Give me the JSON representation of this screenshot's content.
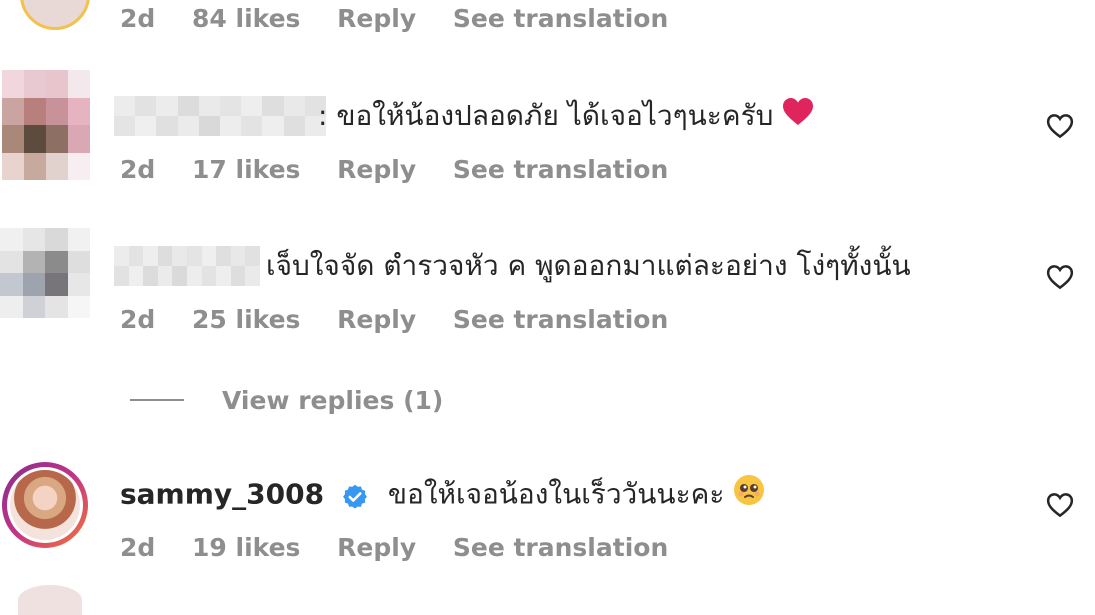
{
  "comments": [
    {
      "text": "",
      "time": "2d",
      "likes": "84 likes",
      "reply": "Reply",
      "translate": "See translation"
    },
    {
      "text": "ขอให้น้องปลอดภัย ได้เจอไวๆนะครับ",
      "time": "2d",
      "likes": "17 likes",
      "reply": "Reply",
      "translate": "See translation"
    },
    {
      "text": "เจ็บใจจัด ตำรวจหัว ค พูดออกมาแต่ละอย่าง โง่ๆทั้งนั้น",
      "time": "2d",
      "likes": "25 likes",
      "reply": "Reply",
      "translate": "See translation",
      "view_replies": "View replies (1)"
    },
    {
      "username": "sammy_3008",
      "text": "ขอให้เจอน้องในเร็ววันนะคะ",
      "time": "2d",
      "likes": "19 likes",
      "reply": "Reply",
      "translate": "See translation"
    }
  ],
  "icons": {
    "like": "heart-outline-icon",
    "verified": "verified-badge-icon",
    "red_heart": "red-heart-emoji-icon",
    "pleading_face": "pleading-face-emoji-icon"
  },
  "colors": {
    "primary_text": "#262626",
    "secondary_text": "#8e8e8e",
    "verified_blue": "#3897f0",
    "heart_red": "#e0245e",
    "avatar_ring": "#c13584"
  }
}
